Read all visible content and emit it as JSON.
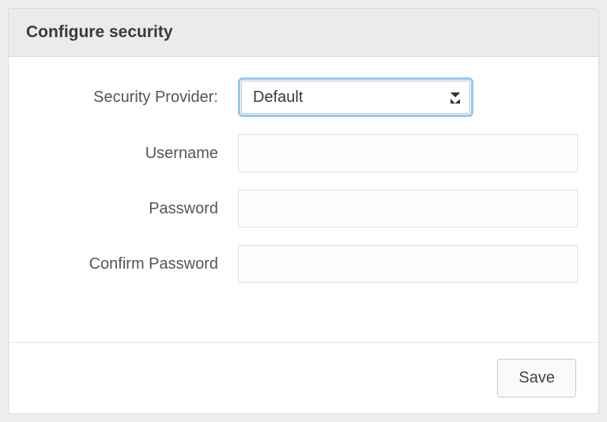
{
  "panel": {
    "title": "Configure security"
  },
  "form": {
    "securityProvider": {
      "label": "Security Provider:",
      "value": "Default"
    },
    "username": {
      "label": "Username",
      "value": ""
    },
    "password": {
      "label": "Password",
      "value": ""
    },
    "confirmPassword": {
      "label": "Confirm Password",
      "value": ""
    }
  },
  "actions": {
    "save": "Save"
  }
}
